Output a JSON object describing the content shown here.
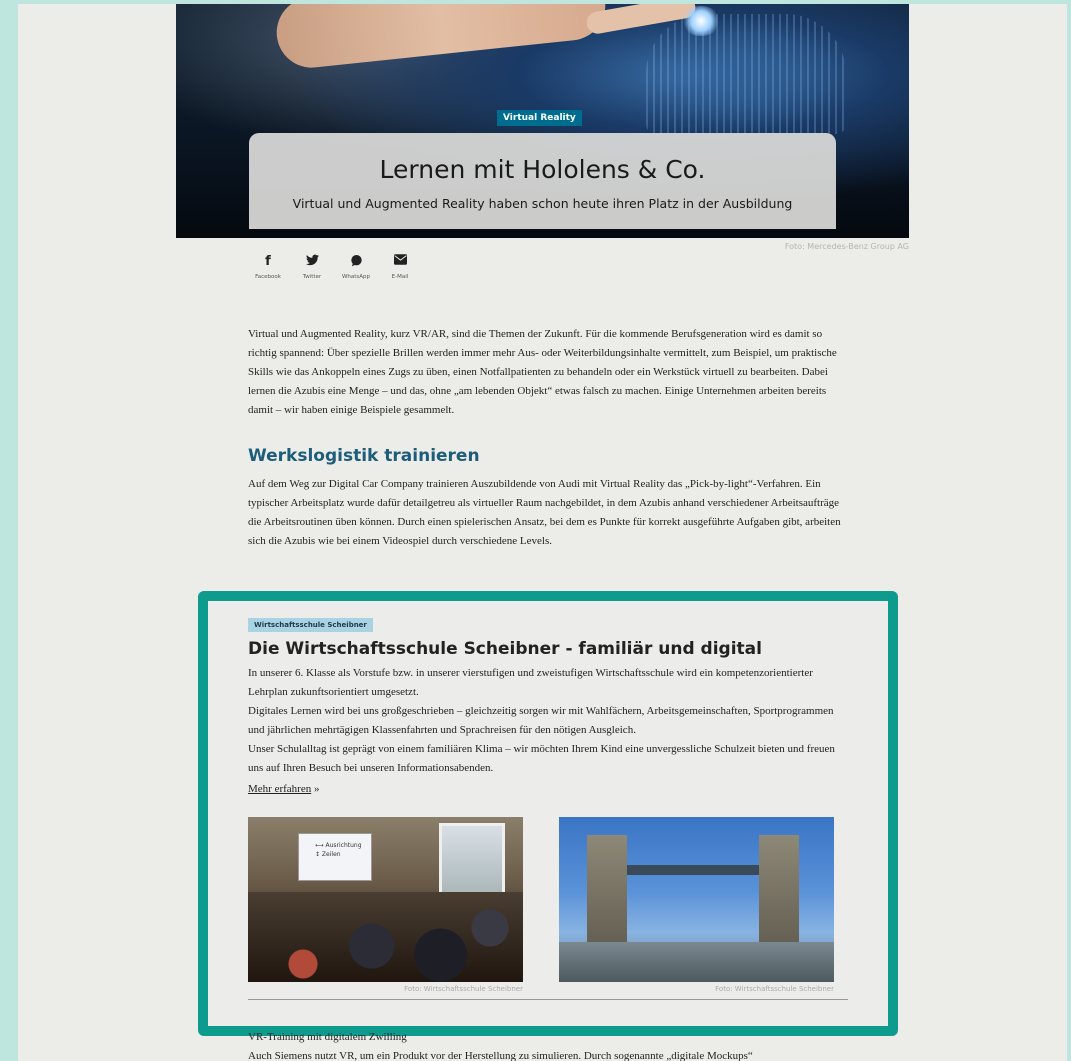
{
  "hero": {
    "tag": "Virtual Reality",
    "title": "Lernen mit Hololens & Co.",
    "subtitle": "Virtual und Augmented Reality haben schon heute ihren Platz in der Ausbildung",
    "credit": "Foto: Mercedes-Benz Group AG"
  },
  "share": [
    {
      "icon": "f",
      "label": "Facebook"
    },
    {
      "icon": "🐦",
      "label": "Twitter"
    },
    {
      "icon": "✆",
      "label": "WhatsApp"
    },
    {
      "icon": "✉",
      "label": "E-Mail"
    }
  ],
  "intro": "Virtual und Augmented Reality, kurz VR/AR, sind die Themen der Zukunft. Für die kommende Berufsgeneration wird es damit so richtig spannend: Über spezielle Brillen werden immer mehr Aus- oder Weiterbildungsinhalte vermittelt, zum Beispiel, um praktische Skills wie das Ankoppeln eines Zugs zu üben, einen Notfallpatienten zu behandeln oder ein Werkstück virtuell zu bearbeiten. Dabei lernen die Azubis eine Menge – und das, ohne „am lebenden Objekt“ etwas falsch zu machen. Einige Unternehmen arbeiten bereits damit – wir haben einige Beispiele gesammelt.",
  "section1": {
    "heading": "Werkslogistik trainieren",
    "text": "Auf dem Weg zur Digital Car Company trainieren Auszubildende von Audi mit Virtual Reality das „Pick-by-light“-Verfahren. Ein typischer Arbeitsplatz wurde dafür detailgetreu als virtueller Raum nachgebildet, in dem Azubis anhand verschiedener Arbeitsaufträge die Arbeitsroutinen üben können. Durch einen spielerischen Ansatz, bei dem es Punkte für korrekt ausgeführte Aufgaben gibt, arbeiten sich die Azubis wie bei einem Videospiel durch verschiedene Levels."
  },
  "promo": {
    "tag": "Wirtschaftsschule Scheibner",
    "title": "Die Wirtschaftsschule Scheibner - familiär und digital",
    "line1": "In unserer 6. Klasse als Vorstufe bzw. in unserer vierstufigen und zweistufigen Wirtschaftsschule wird ein kompetenzorientierter Lehrplan zukunftsorientiert umgesetzt.",
    "line2": "Digitales Lernen wird bei uns großgeschrieben – gleichzeitig sorgen wir mit Wahlfächern, Arbeitsgemeinschaften, Sportprogrammen und jährlichen mehrtägigen Klassenfahrten und Sprachreisen für den nötigen Ausgleich.",
    "line3": "Unser Schulalltag ist geprägt von einem familiären Klima – wir möchten Ihrem Kind eine unvergessliche Schulzeit bieten und freuen uns auf Ihren Besuch bei unseren Informationsabenden.",
    "link": "Mehr erfahren",
    "link_suffix": " »",
    "photo1_caption": "Foto: Wirtschaftsschule Scheibner",
    "photo2_caption": "Foto: Wirtschaftsschule Scheibner",
    "board_text1": "⟷ Ausrichtung",
    "board_text2": "↕ Zeilen"
  },
  "bottom": {
    "heading": "VR-Training mit digitalem Zwilling",
    "text": "Auch Siemens nutzt VR, um ein Produkt vor der Herstellung zu simulieren. Durch sogenannte „digitale Mockups“"
  }
}
